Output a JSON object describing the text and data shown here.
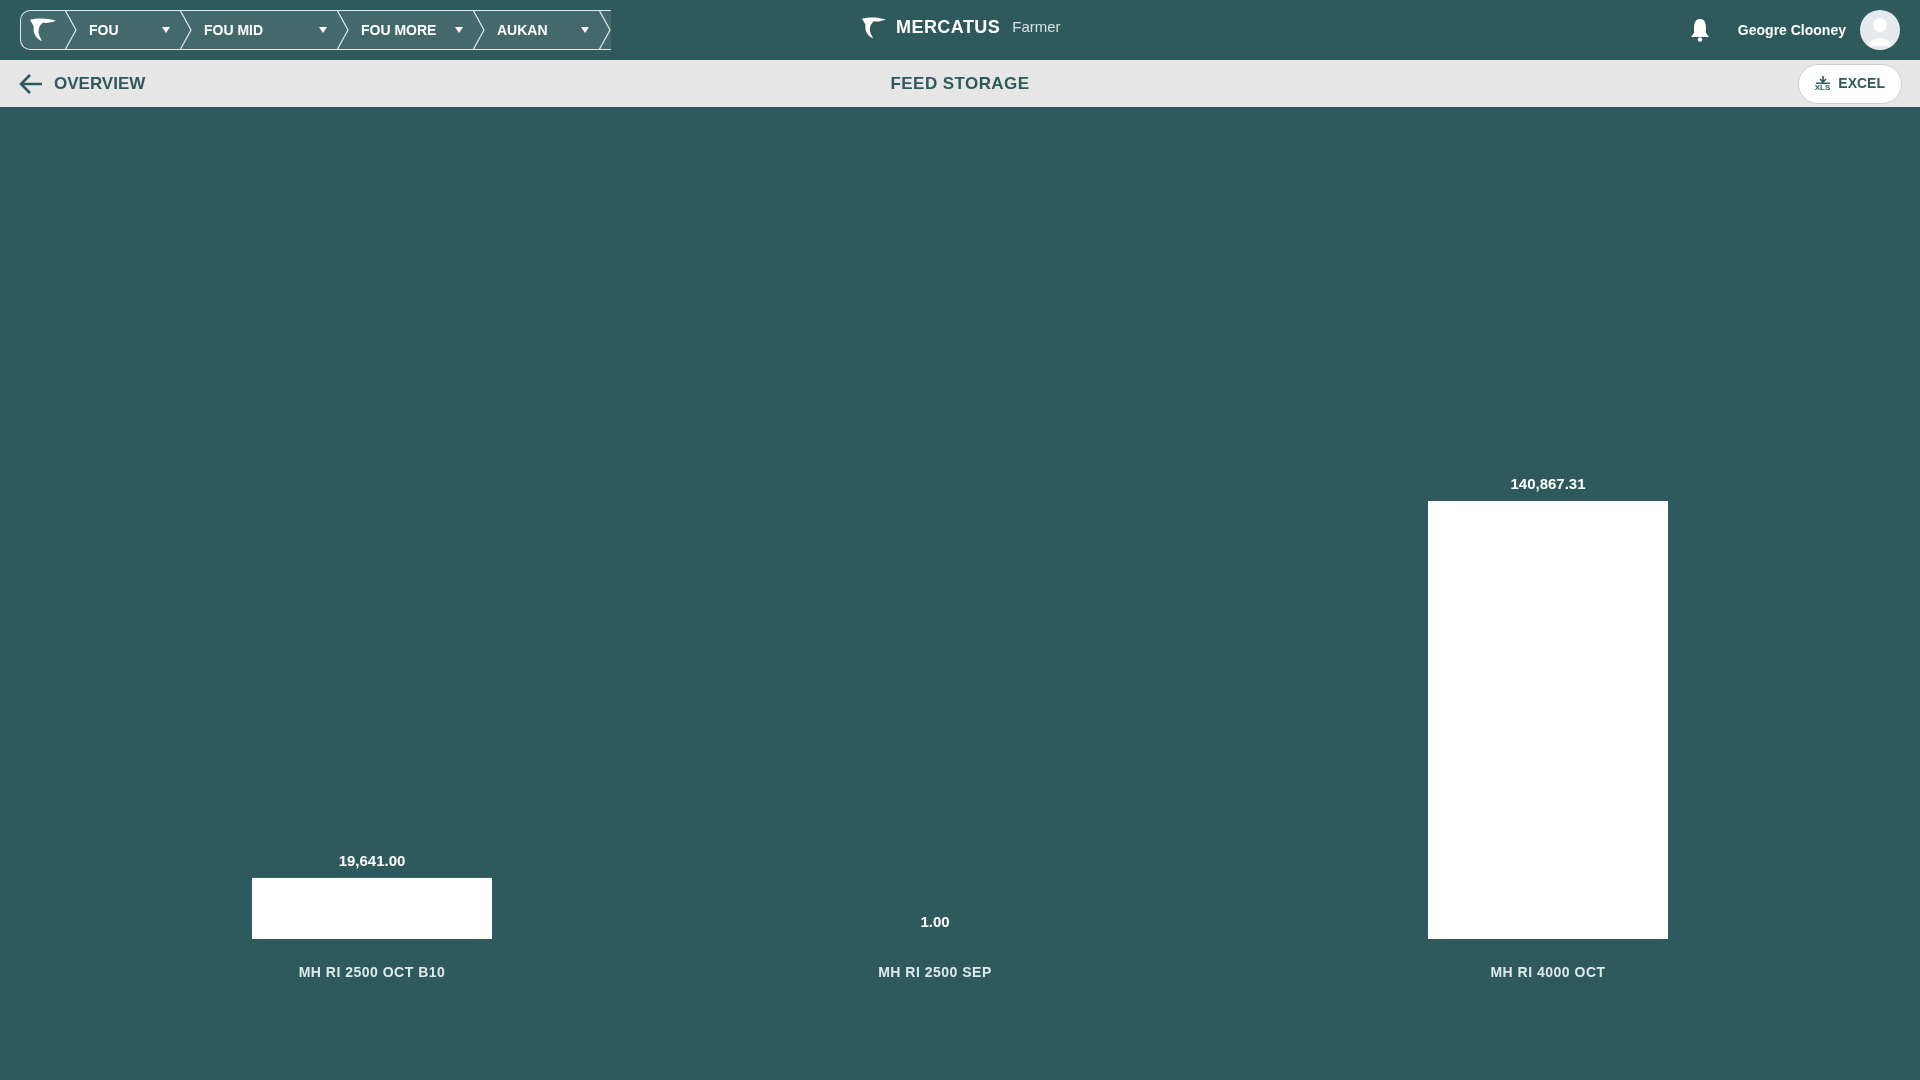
{
  "breadcrumbs": [
    {
      "label": "FOU"
    },
    {
      "label": "FOU MID"
    },
    {
      "label": "FOU MORE"
    },
    {
      "label": "AUKAN"
    }
  ],
  "brand": {
    "name": "MERCATUS",
    "product": "Farmer"
  },
  "user": {
    "name": "Geogre Clooney"
  },
  "subbar": {
    "back_label": "OVERVIEW",
    "title": "FEED STORAGE",
    "export_label": "EXCEL",
    "export_icon_text": "XLS"
  },
  "chart_data": {
    "type": "bar",
    "categories": [
      "MH RI 2500 OCT B10",
      "MH RI 2500 SEP",
      "MH RI 4000 OCT"
    ],
    "values": [
      19641.0,
      1.0,
      140867.31
    ],
    "value_labels": [
      "19,641.00",
      "1.00",
      "140,867.31"
    ],
    "data_labels": true
  }
}
